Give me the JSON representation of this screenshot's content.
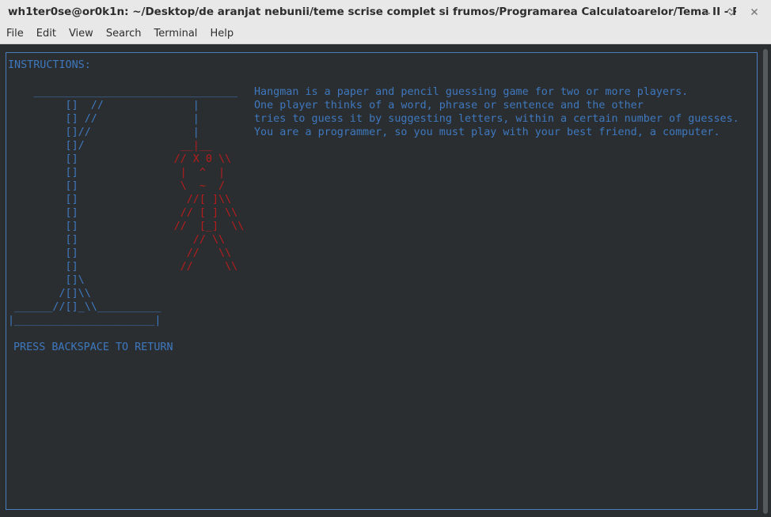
{
  "window": {
    "title": "wh1ter0se@or0k1n: ~/Desktop/de aranjat nebunii/teme scrise complet si frumos/Programarea Calculatoarelor/Tema II  - PRC",
    "controls": {
      "minimize_icon": "minimize-icon",
      "maximize_icon": "maximize-icon",
      "close_icon": "close-icon"
    }
  },
  "menu": {
    "items": [
      "File",
      "Edit",
      "View",
      "Search",
      "Terminal",
      "Help"
    ]
  },
  "terminal": {
    "heading": "INSTRUCTIONS:",
    "gallows_art": "    ________________________________\n         []  //              |\n         [] //               |\n         []//                |\n         []/               __|__\n         []               // X 0 \\\\\n         []                |  ^  |\n         []                \\  ~  /\n         []                 //[ ]\\\\\n         []                // [ ] \\\\\n         []               //  [_]  \\\\\n         []                  // \\\\\n         []                 //   \\\\\n         []                //     \\\\\n         []\\\n        /[]\\\\\n ______//[]_\\\\__________\n|______________________|",
    "gallows_frame": "    ________________________________\n         []  //              |\n         [] //               |\n         []//                |\n         []/                 \n         []                      \n         []                      \n         []                      \n         []                      \n         []                      \n         []                      \n         []                      \n         []                      \n         []                      \n         []\\\n        /[]\\\\\n ______//[]_\\\\__________\n|______________________|",
    "hangman_art": "\n\n\n\n                           __|__\n                          // X 0 \\\\\n                           |  ^  |\n                           \\  ~  /\n                            //[ ]\\\\\n                           // [ ] \\\\\n                          //  [_]  \\\\\n                             // \\\\\n                            //   \\\\\n                           //     \\\\",
    "description_lines": [
      "Hangman is a paper and pencil guessing game for two or more players.",
      "One player thinks of a word, phrase or sentence and the other",
      "tries to guess it by suggesting letters, within a certain number of guesses.",
      "You are a programmer, so you must play with your best friend, a computer."
    ],
    "footer_prompt": "PRESS BACKSPACE TO RETURN",
    "colors": {
      "background": "#2b2e30",
      "text_blue": "#3e78bf",
      "figure_red": "#b81d1d"
    }
  }
}
